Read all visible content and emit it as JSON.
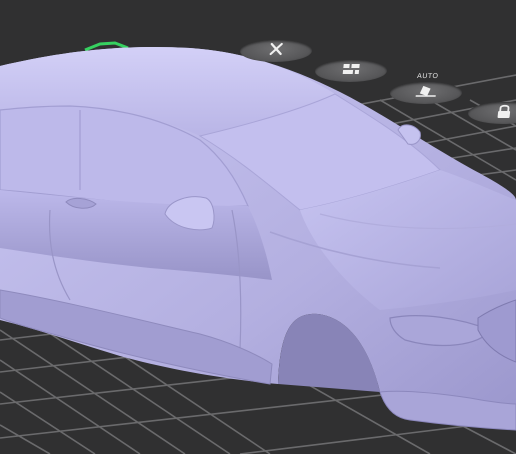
{
  "viewport": {
    "background": "#303031",
    "grid_color": "#6a6a6c",
    "model_color": "#b8b4e6",
    "selection_outline_color": "#36d160"
  },
  "toolbar": {
    "buttons": [
      {
        "name": "delete-button",
        "icon": "close-icon"
      },
      {
        "name": "layout-button",
        "icon": "arrange-icon"
      },
      {
        "name": "auto-orient-button",
        "icon": "auto-orient-icon",
        "label": "AUTO"
      },
      {
        "name": "lock-button",
        "icon": "lock-icon"
      }
    ]
  }
}
